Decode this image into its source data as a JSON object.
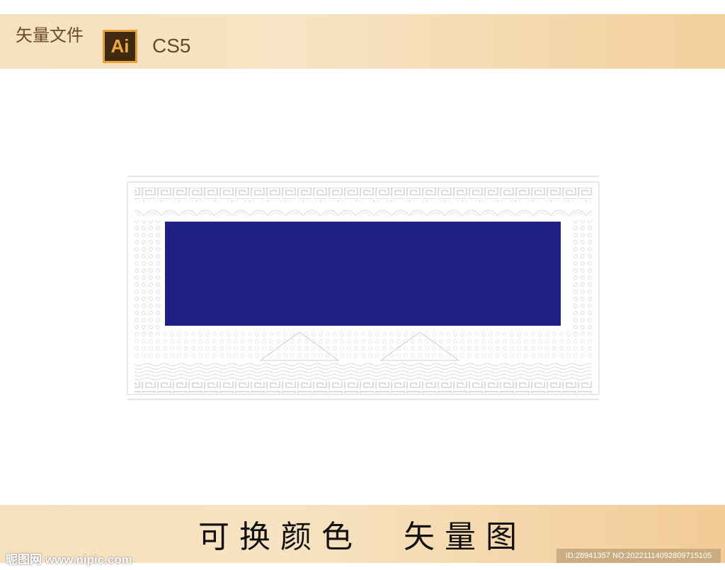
{
  "header": {
    "label": "矢量文件",
    "badge": "Ai",
    "version": "CS5"
  },
  "artwork": {
    "panel_color": "#1e2086",
    "ornament_color": "#d8d8d8"
  },
  "footer": {
    "title": "可换颜色　矢量图"
  },
  "watermark": {
    "site": "昵图网 www.nipic.com",
    "id": "ID:28941357 NO:20221114092809715105"
  },
  "colors": {
    "band": "#f5d9ae",
    "text": "#6a4a26"
  }
}
